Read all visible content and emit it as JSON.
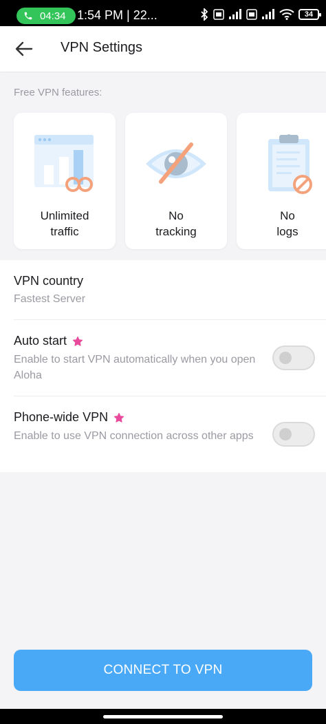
{
  "status_bar": {
    "call_timer": "04:34",
    "time_text": "1:54 PM | 22...",
    "battery": "34"
  },
  "header": {
    "title": "VPN Settings"
  },
  "features": {
    "label": "Free VPN features:",
    "cards": [
      {
        "label": "Unlimited\ntraffic",
        "icon": "unlimited-traffic-icon"
      },
      {
        "label": "No\ntracking",
        "icon": "no-tracking-icon"
      },
      {
        "label": "No\nlogs",
        "icon": "no-logs-icon"
      }
    ]
  },
  "settings": {
    "vpn_country": {
      "title": "VPN country",
      "value": "Fastest Server"
    },
    "auto_start": {
      "title": "Auto start",
      "description": "Enable to start VPN automatically when you open Aloha",
      "enabled": false
    },
    "phone_wide": {
      "title": "Phone-wide VPN",
      "description": "Enable to use VPN connection across other apps",
      "enabled": false
    }
  },
  "connect_button": {
    "label": "CONNECT TO VPN"
  },
  "colors": {
    "accent": "#4aa9f6",
    "premium_star": "#e94b9c",
    "call_green": "#33c45a",
    "illustration_blue": "#cfe6fb",
    "illustration_orange": "#f3a27c"
  }
}
